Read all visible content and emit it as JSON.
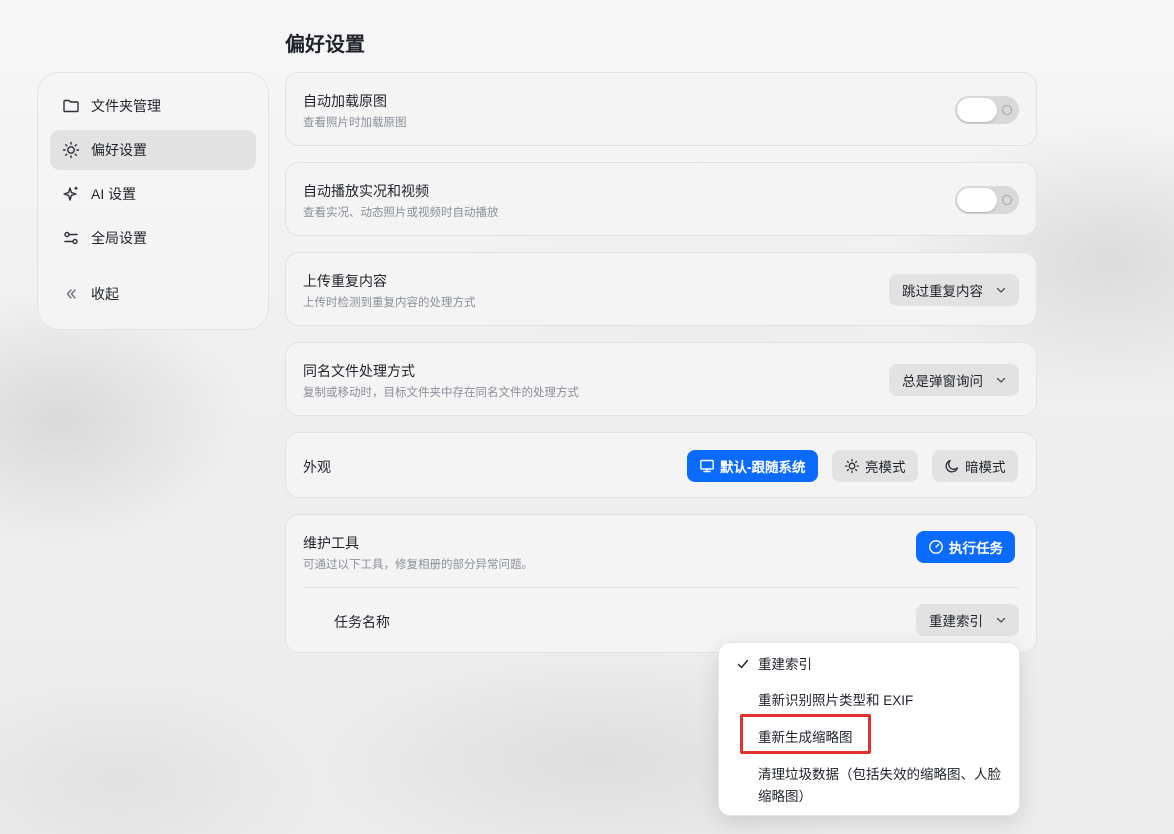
{
  "page": {
    "title": "偏好设置"
  },
  "sidebar": {
    "items": [
      {
        "label": "文件夹管理",
        "icon": "folder-icon"
      },
      {
        "label": "偏好设置",
        "icon": "sun-icon"
      },
      {
        "label": "AI 设置",
        "icon": "sparkle-icon"
      },
      {
        "label": "全局设置",
        "icon": "sliders-icon"
      }
    ],
    "active": "偏好设置",
    "collapse_label": "收起"
  },
  "settings": {
    "auto_load_original": {
      "title": "自动加载原图",
      "desc": "查看照片时加载原图",
      "enabled": false
    },
    "autoplay_live": {
      "title": "自动播放实况和视频",
      "desc": "查看实况、动态照片或视频时自动播放",
      "enabled": false
    },
    "upload_duplicates": {
      "title": "上传重复内容",
      "desc": "上传时检测到重复内容的处理方式",
      "value": "跳过重复内容"
    },
    "same_name": {
      "title": "同名文件处理方式",
      "desc": "复制或移动时，目标文件夹中存在同名文件的处理方式",
      "value": "总是弹窗询问"
    },
    "appearance": {
      "title": "外观",
      "options": [
        {
          "label": "默认-跟随系统",
          "icon": "monitor-icon",
          "selected": true
        },
        {
          "label": "亮模式",
          "icon": "sun-icon",
          "selected": false
        },
        {
          "label": "暗模式",
          "icon": "moon-icon",
          "selected": false
        }
      ]
    },
    "maintenance": {
      "title": "维护工具",
      "desc": "可通过以下工具，修复相册的部分异常问题。",
      "run_label": "执行任务",
      "task_label": "任务名称",
      "task_value": "重建索引"
    }
  },
  "dropdown": {
    "options": [
      {
        "label": "重建索引",
        "checked": true
      },
      {
        "label": "重新识别照片类型和 EXIF",
        "checked": false
      },
      {
        "label": "重新生成缩略图",
        "checked": false,
        "highlighted": true
      },
      {
        "label": "清理垃圾数据（包括失效的缩略图、人脸缩略图）",
        "checked": false
      }
    ]
  },
  "colors": {
    "accent": "#0b6bff",
    "highlight_border": "#e0302f"
  }
}
